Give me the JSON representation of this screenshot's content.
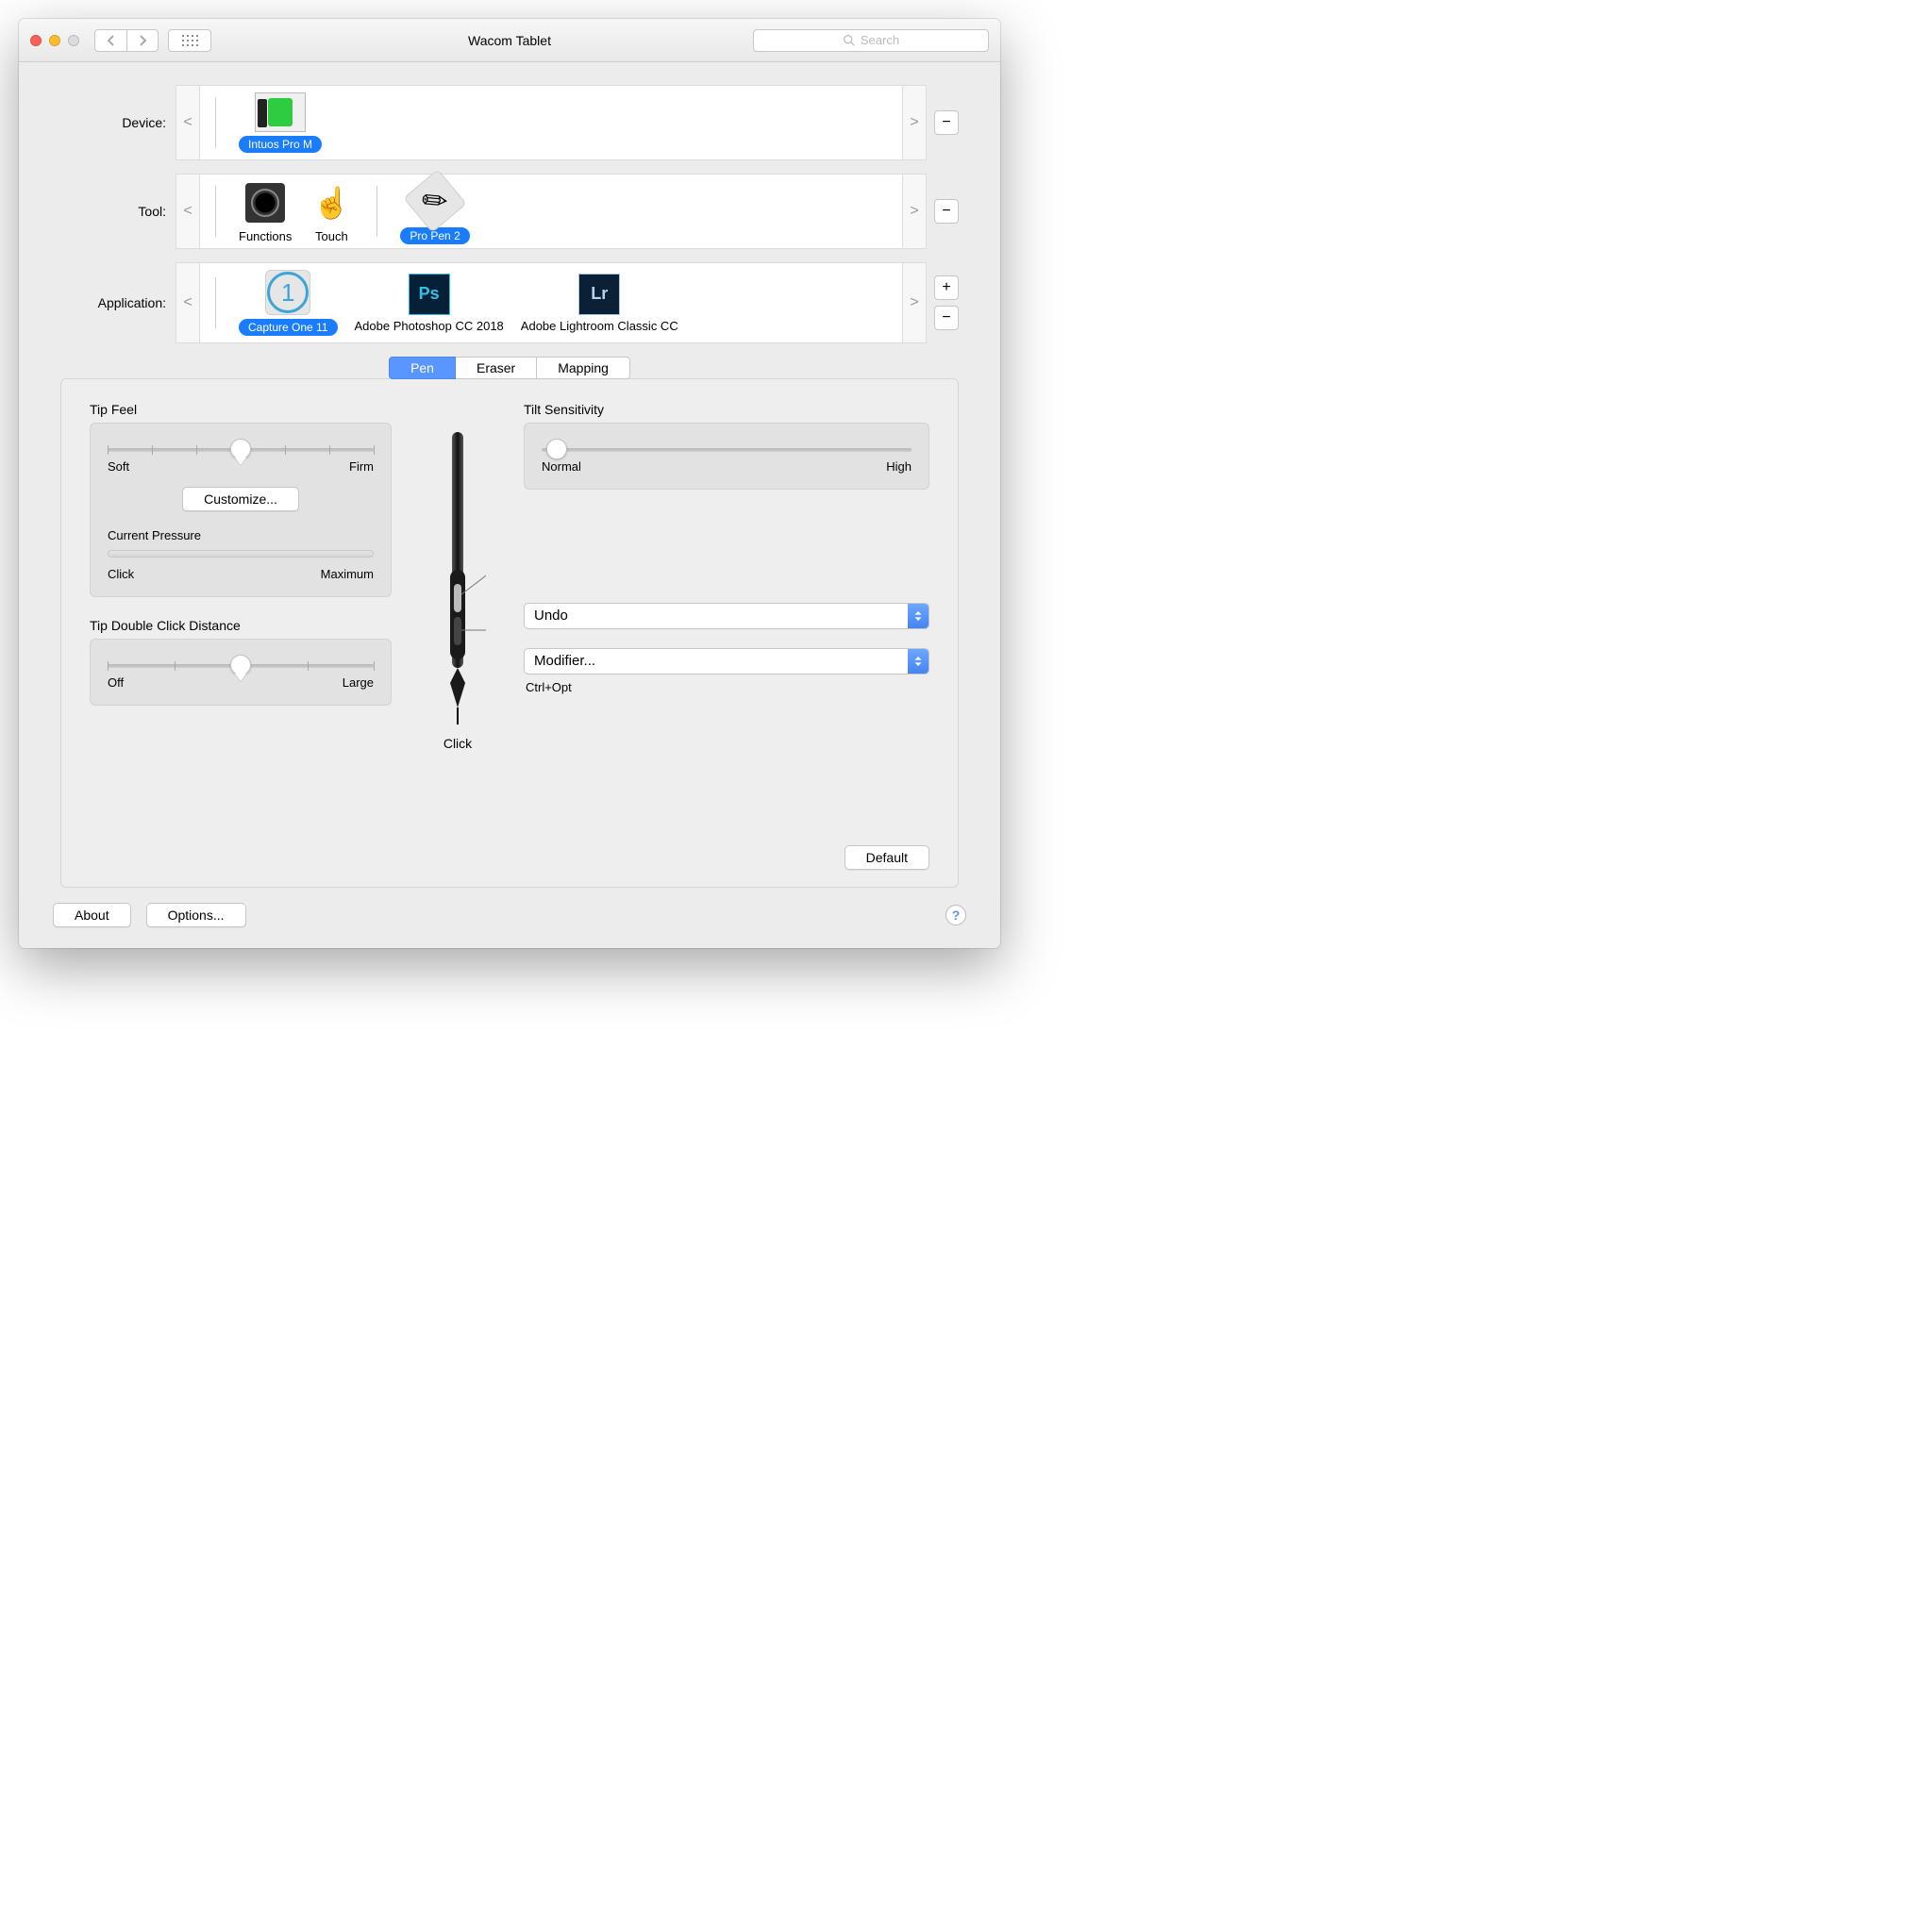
{
  "window": {
    "title": "Wacom Tablet",
    "search_placeholder": "Search"
  },
  "rows": {
    "device": {
      "label": "Device:",
      "items": [
        {
          "name": "Intuos Pro M",
          "selected": true
        }
      ]
    },
    "tool": {
      "label": "Tool:",
      "items": [
        {
          "name": "Functions"
        },
        {
          "name": "Touch"
        },
        {
          "name": "Pro Pen 2",
          "selected": true
        }
      ]
    },
    "application": {
      "label": "Application:",
      "items": [
        {
          "name": "Capture One 11",
          "selected": true
        },
        {
          "name": "Adobe Photoshop CC 2018"
        },
        {
          "name": "Adobe Lightroom Classic CC"
        }
      ]
    }
  },
  "tabs": {
    "pen": "Pen",
    "eraser": "Eraser",
    "mapping": "Mapping"
  },
  "tip_feel": {
    "label": "Tip Feel",
    "soft": "Soft",
    "firm": "Firm",
    "customize": "Customize..."
  },
  "current_pressure": {
    "label": "Current Pressure",
    "click": "Click",
    "max": "Maximum"
  },
  "double_click": {
    "label": "Tip Double Click Distance",
    "off": "Off",
    "large": "Large"
  },
  "tilt": {
    "label": "Tilt Sensitivity",
    "normal": "Normal",
    "high": "High"
  },
  "pen_buttons": {
    "upper": "Undo",
    "lower": "Modifier...",
    "lower_sub": "Ctrl+Opt",
    "tip": "Click"
  },
  "buttons": {
    "default": "Default",
    "about": "About",
    "options": "Options..."
  }
}
